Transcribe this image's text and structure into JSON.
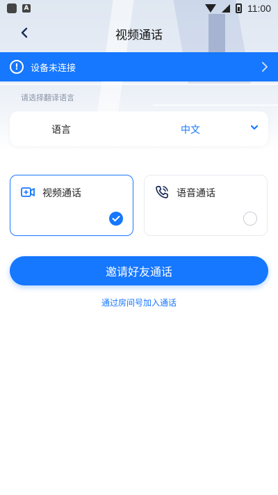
{
  "status_bar": {
    "time": "11:00",
    "notification_icons": [
      "app-notification-icon",
      "a-notification-icon"
    ],
    "system_icons": [
      "wifi-icon",
      "signal-icon",
      "battery-icon"
    ]
  },
  "nav": {
    "title": "视频通话",
    "back_icon": "chevron-left-icon"
  },
  "alert": {
    "text": "设备未连接",
    "icon": "exclamation-icon",
    "icon_glyph": "!",
    "color": "#1677ff"
  },
  "language": {
    "hint": "请选择翻译语言",
    "label": "语言",
    "value": "中文"
  },
  "call_options": {
    "video": {
      "label": "视频通话",
      "selected": true,
      "icon": "video-camera-icon"
    },
    "voice": {
      "label": "语音通话",
      "selected": false,
      "icon": "phone-icon"
    }
  },
  "actions": {
    "invite_label": "邀请好友通话",
    "room_link": "通过房间号加入通话"
  },
  "colors": {
    "accent": "#1677ff",
    "hint_text": "#8a94a6"
  }
}
